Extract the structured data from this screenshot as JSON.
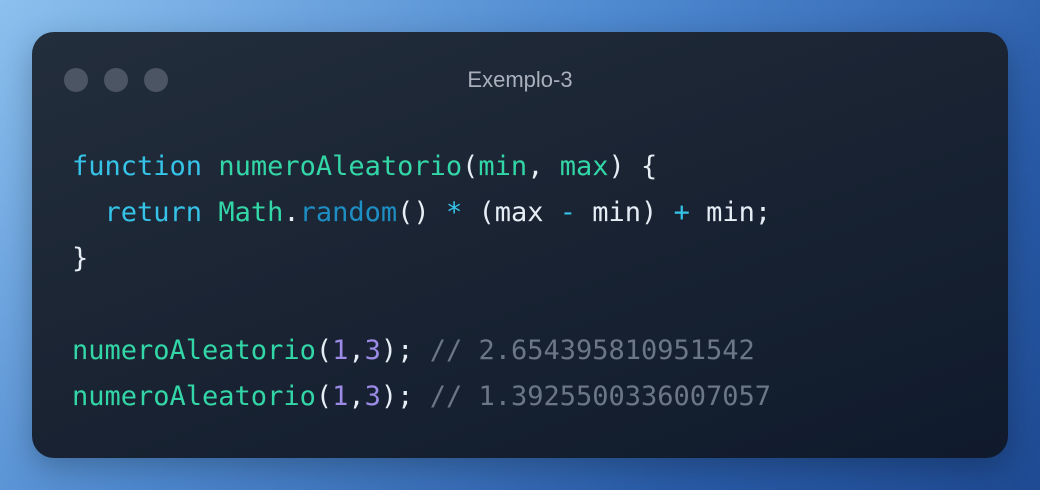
{
  "window": {
    "title": "Exemplo-3",
    "controls": [
      "dot-1",
      "dot-2",
      "dot-3"
    ]
  },
  "code": {
    "lines": [
      [
        {
          "t": "function",
          "k": "kw"
        },
        {
          "t": " ",
          "k": "pl"
        },
        {
          "t": "numeroAleatorio",
          "k": "fn"
        },
        {
          "t": "(",
          "k": "pl"
        },
        {
          "t": "min",
          "k": "param"
        },
        {
          "t": ", ",
          "k": "pl"
        },
        {
          "t": "max",
          "k": "param"
        },
        {
          "t": ") {",
          "k": "pl"
        }
      ],
      [
        {
          "t": "  ",
          "k": "pl"
        },
        {
          "t": "return",
          "k": "kw"
        },
        {
          "t": " ",
          "k": "pl"
        },
        {
          "t": "Math",
          "k": "obj"
        },
        {
          "t": ".",
          "k": "pl"
        },
        {
          "t": "random",
          "k": "meth"
        },
        {
          "t": "() ",
          "k": "pl"
        },
        {
          "t": "*",
          "k": "op"
        },
        {
          "t": " (max ",
          "k": "pl"
        },
        {
          "t": "-",
          "k": "op"
        },
        {
          "t": " min) ",
          "k": "pl"
        },
        {
          "t": "+",
          "k": "op"
        },
        {
          "t": " min;",
          "k": "pl"
        }
      ],
      [
        {
          "t": "}",
          "k": "pl"
        }
      ],
      [],
      [
        {
          "t": "numeroAleatorio",
          "k": "fn"
        },
        {
          "t": "(",
          "k": "pl"
        },
        {
          "t": "1",
          "k": "num"
        },
        {
          "t": ",",
          "k": "pl"
        },
        {
          "t": "3",
          "k": "num"
        },
        {
          "t": "); ",
          "k": "pl"
        },
        {
          "t": "// 2.654395810951542",
          "k": "cm"
        }
      ],
      [
        {
          "t": "numeroAleatorio",
          "k": "fn"
        },
        {
          "t": "(",
          "k": "pl"
        },
        {
          "t": "1",
          "k": "num"
        },
        {
          "t": ",",
          "k": "pl"
        },
        {
          "t": "3",
          "k": "num"
        },
        {
          "t": "); ",
          "k": "pl"
        },
        {
          "t": "// 1.3925500336007057",
          "k": "cm"
        }
      ]
    ]
  }
}
